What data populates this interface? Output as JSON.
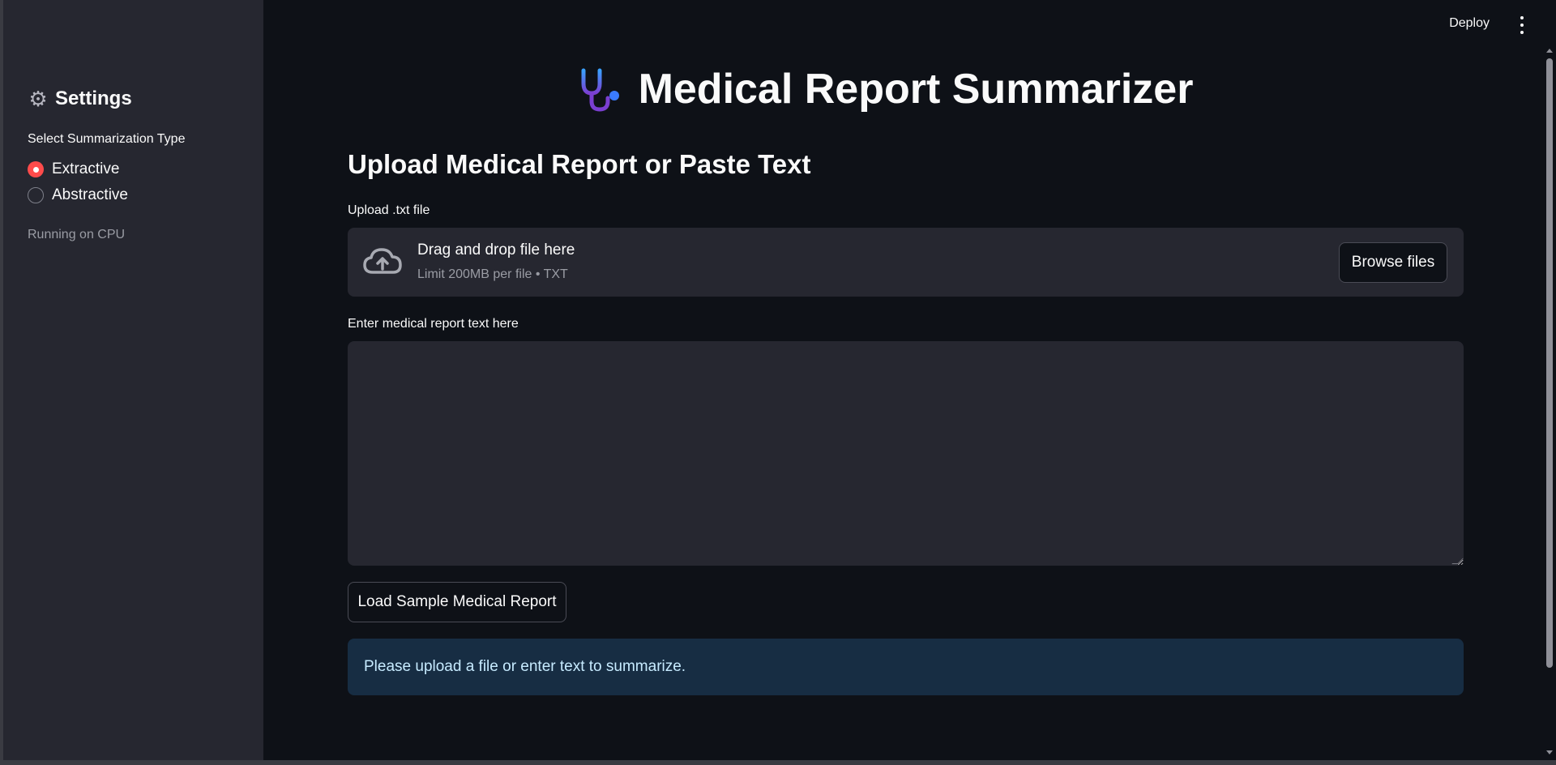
{
  "header": {
    "deploy_label": "Deploy",
    "menu_icon": "kebab-menu-icon"
  },
  "sidebar": {
    "title": "Settings",
    "title_icon": "gear-icon",
    "radio_label": "Select Summarization Type",
    "options": [
      {
        "label": "Extractive",
        "selected": true
      },
      {
        "label": "Abstractive",
        "selected": false
      }
    ],
    "status": "Running on CPU"
  },
  "main": {
    "title": "Medical Report Summarizer",
    "title_icon": "stethoscope-icon",
    "section_title": "Upload Medical Report or Paste Text",
    "upload": {
      "label": "Upload .txt file",
      "drop_title": "Drag and drop file here",
      "drop_subtitle": "Limit 200MB per file • TXT",
      "browse_label": "Browse files",
      "icon": "cloud-upload-icon"
    },
    "text_input": {
      "label": "Enter medical report text here",
      "value": "",
      "placeholder": ""
    },
    "sample_button_label": "Load Sample Medical Report",
    "info_message": "Please upload a file or enter text to summarize."
  },
  "colors": {
    "background": "#0e1117",
    "sidebar": "#262730",
    "accent": "#ff4b4b",
    "info_bg": "#172d43",
    "info_text": "#c7ebff"
  }
}
